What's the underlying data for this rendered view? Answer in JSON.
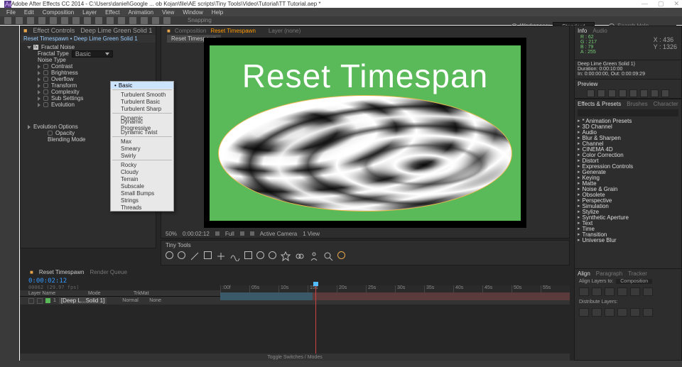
{
  "window": {
    "title": "Adobe After Effects CC 2014 - C:\\Users\\daniel\\Google ... ob Kojan\\file\\AE scripts\\Tiny Tools\\Video\\Tutorial\\TT Tutorial.aep *",
    "btn_min": "—",
    "btn_max": "▢",
    "btn_close": "✕"
  },
  "menu": [
    "File",
    "Edit",
    "Composition",
    "Layer",
    "Effect",
    "Animation",
    "View",
    "Window",
    "Help"
  ],
  "workspace": {
    "label": "Workspace:",
    "value": "Standard"
  },
  "search": {
    "placeholder": "Search Help"
  },
  "effect_controls": {
    "panel_title": "Effect Controls",
    "panel_subject": "Deep Lime Green Solid 1",
    "breadcrumb": "Reset Timespawn • Deep Lime Green Solid 1",
    "fx_name": "Fractal Noise",
    "props": [
      {
        "label": "Fractal Type",
        "value": "Basic"
      },
      {
        "label": "Noise Type",
        "value": ""
      }
    ],
    "oprops": [
      "Contrast",
      "Brightness",
      "Overflow",
      "Transform",
      "Complexity",
      "Sub Settings",
      "Evolution"
    ],
    "evo": {
      "label": "Evolution Options",
      "opacity": "Opacity",
      "blend": "Blending Mode"
    }
  },
  "dropdown": {
    "items": [
      "Basic",
      "",
      "Turbulent Smooth",
      "Turbulent Basic",
      "Turbulent Sharp",
      "",
      "Dynamic",
      "Dynamic Progressive",
      "Dynamic Twist",
      "",
      "Max",
      "Smeary",
      "Swirly",
      "",
      "Rocky",
      "Cloudy",
      "Terrain",
      "Subscale",
      "Small Bumps",
      "Strings",
      "Threads"
    ],
    "selected": "Basic"
  },
  "viewer": {
    "tab_comp": "Composition",
    "tab_name": "Reset Timespawn",
    "tab_layer": "Layer (none)",
    "crumb": "Reset Timespawn",
    "canvas_title": "Reset Timespan",
    "footer": {
      "zoom": "50%",
      "time": "0:00:02:12",
      "res": "Full",
      "cam": "Active Camera",
      "view": "1 View"
    }
  },
  "info_panel": {
    "tab": "Info",
    "tab2": "Audio",
    "r": "R : 62",
    "g": "G : 217",
    "b": "B : 79",
    "a": "A : 255",
    "x": "X : 436",
    "y": "Y : 1326"
  },
  "meta": {
    "l1": "Deep Lime Green Solid 1)",
    "l2": "Duration: 0:00:10:00",
    "l3": "In: 0:00:00:00, Out: 0:00:09:29"
  },
  "preview": {
    "title": "Preview"
  },
  "effects_presets": {
    "tabs": [
      "Effects & Presets",
      "Brushes",
      "Character"
    ],
    "items": [
      "* Animation Presets",
      "3D Channel",
      "Audio",
      "Blur & Sharpen",
      "Channel",
      "CINEMA 4D",
      "Color Correction",
      "Distort",
      "Expression Controls",
      "Generate",
      "Keying",
      "Matte",
      "Noise & Grain",
      "Obsolete",
      "Perspective",
      "Simulation",
      "Stylize",
      "Synthetic Aperture",
      "Text",
      "Time",
      "Transition",
      "Universe Blur"
    ]
  },
  "tiny_tools": {
    "title": "Tiny Tools"
  },
  "timeline": {
    "tab1": "Reset Timespawn",
    "tab2": "Render Queue",
    "timecode": "0:00:02:12",
    "subtc": "00062 (29.97 fps)",
    "hdr_layer": "Layer Name",
    "hdr_mode": "Mode",
    "hdr_trk": "TrkMat",
    "layer": "[Deep L...Solid 1]",
    "mode": "Normal",
    "trk": "None",
    "ticks": [
      ":00f",
      "05s",
      "10s",
      "15s",
      "20s",
      "25s",
      "30s",
      "35s",
      "40s",
      "45s",
      "50s",
      "55s"
    ],
    "footer": "Toggle Switches / Modes"
  },
  "align": {
    "tabs": [
      "Align",
      "Paragraph",
      "Tracker"
    ],
    "label": "Align Layers to:",
    "value": "Composition",
    "dist": "Distribute Layers:"
  }
}
